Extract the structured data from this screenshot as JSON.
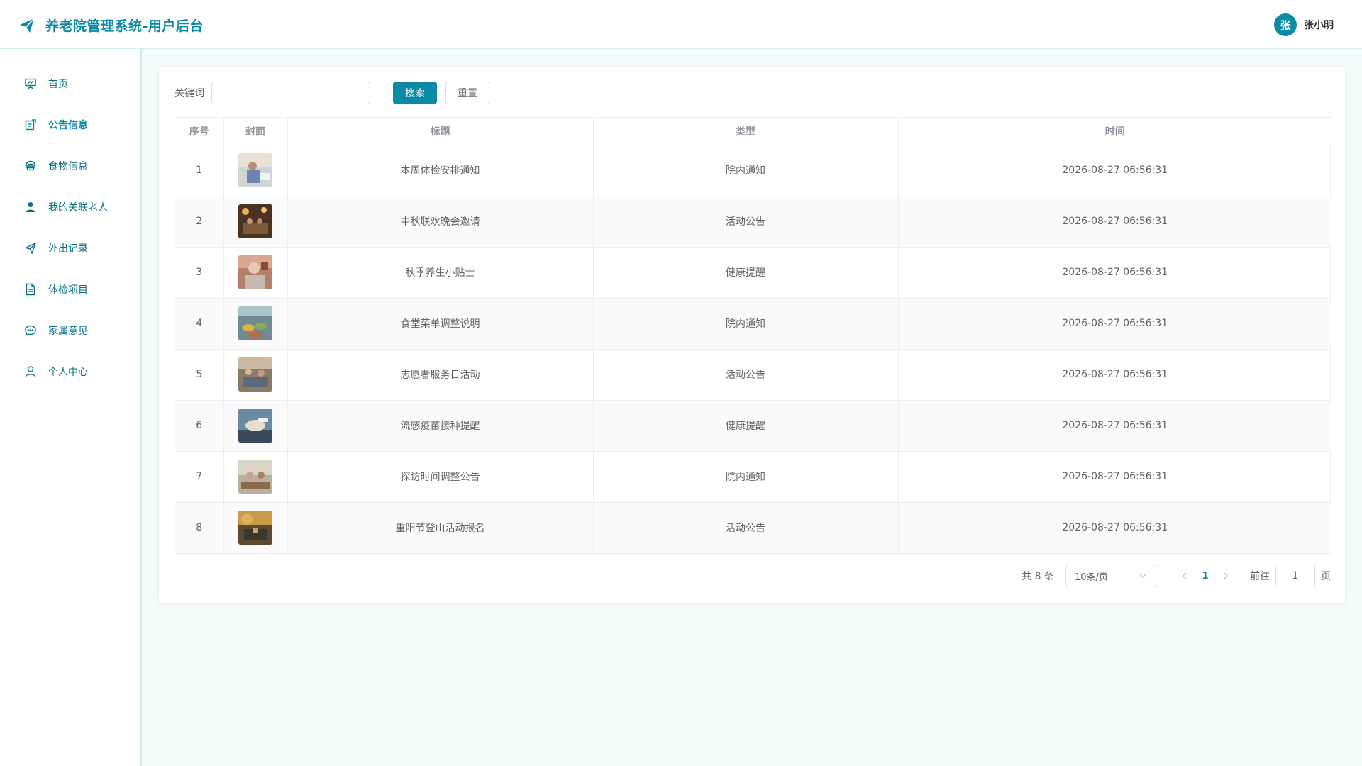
{
  "app": {
    "title": "养老院管理系统-用户后台"
  },
  "user": {
    "avatar_text": "张",
    "name": "张小明"
  },
  "sidebar": {
    "items": [
      {
        "label": "首页",
        "icon": "presentation-icon",
        "active": false
      },
      {
        "label": "公告信息",
        "icon": "notice-icon",
        "active": true
      },
      {
        "label": "食物信息",
        "icon": "food-icon",
        "active": false
      },
      {
        "label": "我的关联老人",
        "icon": "user-filled-icon",
        "active": false
      },
      {
        "label": "外出记录",
        "icon": "send-icon",
        "active": false
      },
      {
        "label": "体检项目",
        "icon": "document-icon",
        "active": false
      },
      {
        "label": "家属意见",
        "icon": "chat-icon",
        "active": false
      },
      {
        "label": "个人中心",
        "icon": "user-icon",
        "active": false
      }
    ]
  },
  "search": {
    "label": "关键词",
    "value": "",
    "placeholder": "",
    "search_label": "搜索",
    "reset_label": "重置"
  },
  "table": {
    "columns": [
      "序号",
      "封面",
      "标题",
      "类型",
      "时间"
    ],
    "rows": [
      {
        "index": "1",
        "title": "本周体检安排通知",
        "type": "院内通知",
        "time": "2026-08-27 06:56:31"
      },
      {
        "index": "2",
        "title": "中秋联欢晚会邀请",
        "type": "活动公告",
        "time": "2026-08-27 06:56:31"
      },
      {
        "index": "3",
        "title": "秋季养生小贴士",
        "type": "健康提醒",
        "time": "2026-08-27 06:56:31"
      },
      {
        "index": "4",
        "title": "食堂菜单调整说明",
        "type": "院内通知",
        "time": "2026-08-27 06:56:31"
      },
      {
        "index": "5",
        "title": "志愿者服务日活动",
        "type": "活动公告",
        "time": "2026-08-27 06:56:31"
      },
      {
        "index": "6",
        "title": "流感疫苗接种提醒",
        "type": "健康提醒",
        "time": "2026-08-27 06:56:31"
      },
      {
        "index": "7",
        "title": "探访时间调整公告",
        "type": "院内通知",
        "time": "2026-08-27 06:56:31"
      },
      {
        "index": "8",
        "title": "重阳节登山活动报名",
        "type": "活动公告",
        "time": "2026-08-27 06:56:31"
      }
    ]
  },
  "pagination": {
    "total_text": "共 8 条",
    "page_size": "10条/页",
    "current_page": "1",
    "goto_label": "前往",
    "goto_value": "1",
    "page_suffix": "页"
  },
  "colors": {
    "accent": "#0b8aa6",
    "sidebar_border": "#cfeaea",
    "background": "#f4fbfb"
  }
}
